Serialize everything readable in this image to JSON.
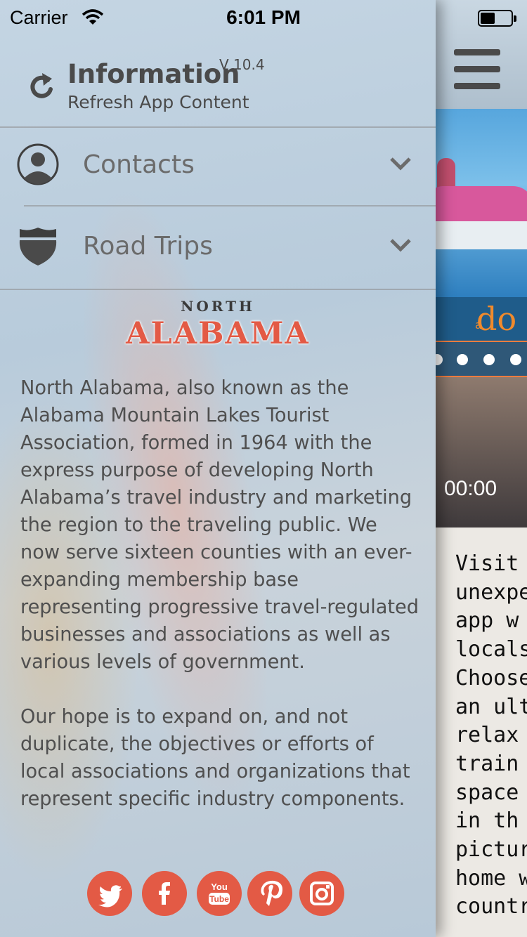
{
  "status_bar": {
    "carrier": "Carrier",
    "time": "6:01 PM"
  },
  "drawer": {
    "info": {
      "title": "Information",
      "version": "V 10.4",
      "subtitle": "Refresh App Content"
    },
    "menu": [
      {
        "label": "Contacts",
        "icon": "person-icon"
      },
      {
        "label": "Road Trips",
        "icon": "highway-shield-icon"
      }
    ],
    "logo": {
      "top": "NORTH",
      "main": "ALABAMA"
    },
    "description": [
      "North Alabama, also known as the Alabama Mountain Lakes Tourist Association, formed in 1964 with the express purpose of developing North Alabama’s travel industry and marketing the region to the traveling public.  We now serve sixteen counties with an ever-expanding membership base representing progressive travel-regulated businesses and associations as well as various levels of government.",
      "Our hope is to expand on, and not duplicate, the objectives or efforts of local associations and organizations that represent specific industry components."
    ],
    "social": [
      {
        "name": "twitter-icon",
        "glyph": "🐦"
      },
      {
        "name": "facebook-icon",
        "glyph": "f"
      },
      {
        "name": "youtube-icon",
        "glyph": "You Tube"
      },
      {
        "name": "pinterest-icon",
        "glyph": "P"
      },
      {
        "name": "instagram-icon",
        "glyph": "◎"
      }
    ],
    "accent_color": "#e35a45"
  },
  "main": {
    "banner_text": "do",
    "banner_prefix": "a",
    "video_time": "00:00",
    "body_lines": [
      "Visit N",
      "unexpe",
      "app w",
      "locals",
      "Choose",
      "an ulti",
      "relax a",
      "train b",
      "space",
      "in th",
      "picture",
      "home w",
      "countr"
    ]
  }
}
